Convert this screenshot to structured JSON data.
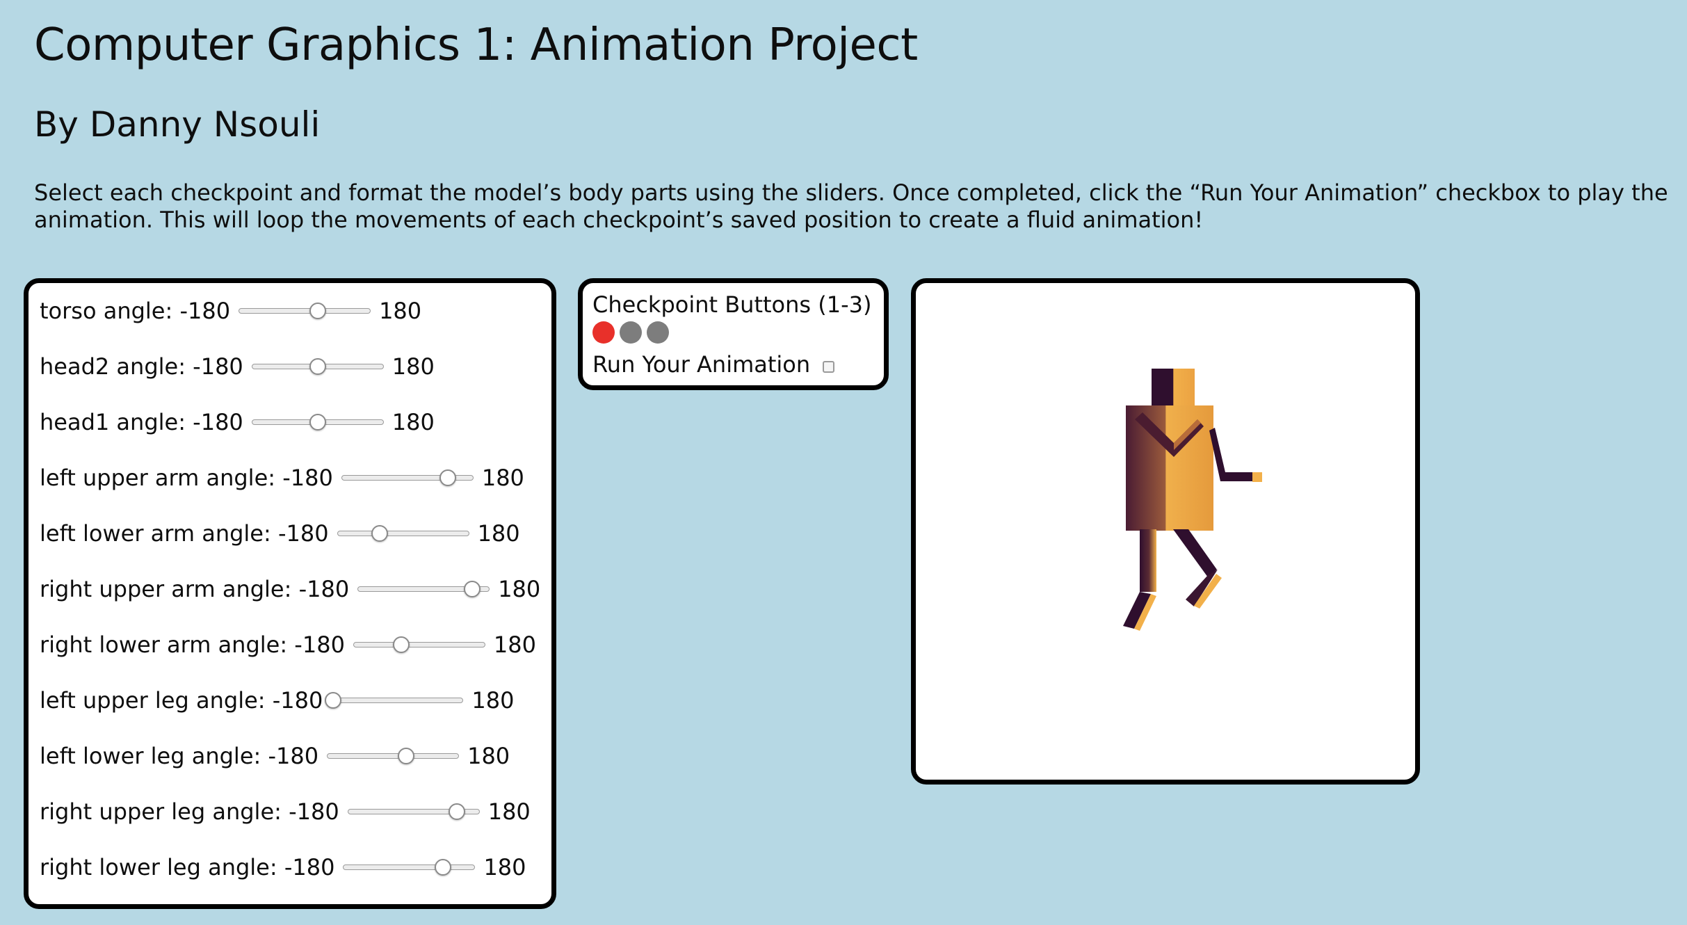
{
  "header": {
    "title": "Computer Graphics 1: Animation Project",
    "subtitle": "By Danny Nsouli",
    "instructions": "Select each checkpoint and format the model’s body parts using the sliders. Once completed, click the “Run Your Animation” checkbox to play the animation. This will loop the movements of each checkpoint’s saved position to create a fluid animation!"
  },
  "sliders": [
    {
      "label": "torso angle: -180",
      "max_label": "180",
      "value_fraction": 0.6
    },
    {
      "label": "head2 angle: -180",
      "max_label": "180",
      "value_fraction": 0.5
    },
    {
      "label": "head1 angle: -180",
      "max_label": "180",
      "value_fraction": 0.5
    },
    {
      "label": "left upper arm angle: -180",
      "max_label": "180",
      "value_fraction": 0.81
    },
    {
      "label": "left lower arm angle: -180",
      "max_label": "180",
      "value_fraction": 0.32
    },
    {
      "label": "right upper arm angle: -180",
      "max_label": "180",
      "value_fraction": 0.87
    },
    {
      "label": "right lower arm angle: -180",
      "max_label": "180",
      "value_fraction": 0.36
    },
    {
      "label": "left upper leg angle: -180",
      "max_label": "180",
      "value_fraction": 0.01
    },
    {
      "label": "left lower leg angle: -180",
      "max_label": "180",
      "value_fraction": 0.6
    },
    {
      "label": "right upper leg angle: -180",
      "max_label": "180",
      "value_fraction": 0.83
    },
    {
      "label": "right lower leg angle: -180",
      "max_label": "180",
      "value_fraction": 0.76
    }
  ],
  "checkpoints": {
    "title": "Checkpoint Buttons (1-3)",
    "buttons": [
      {
        "index": 1,
        "active": true
      },
      {
        "index": 2,
        "active": false
      },
      {
        "index": 3,
        "active": false
      }
    ],
    "run_label": "Run Your Animation",
    "run_checked": false
  },
  "colors": {
    "background": "#b6d8e4",
    "active_checkpoint": "#e8302a",
    "inactive_checkpoint": "#7d7d7d",
    "model_dark": "#2f0f2e",
    "model_light": "#f2b04a"
  }
}
